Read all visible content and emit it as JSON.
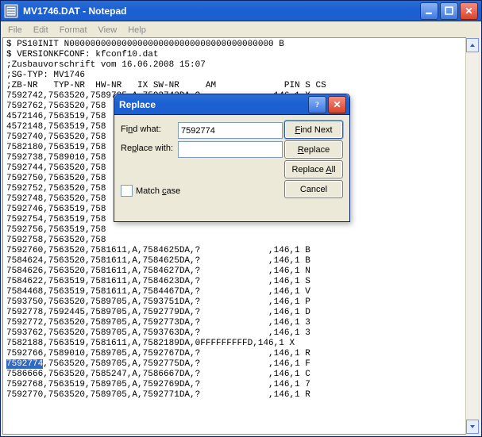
{
  "window": {
    "title": "MV1746.DAT - Notepad",
    "notepad_icon": "notepad-icon"
  },
  "menu": {
    "file": "File",
    "edit": "Edit",
    "format": "Format",
    "view": "View",
    "help": "Help"
  },
  "content": {
    "selected_token": "7592774",
    "lines_before_sel": "$ PS10INIT N000000000000000000000000000000000000000 B\n$ VERSIONKFCONF: kfconf10.dat\n;Zusbauvorschrift vom 16.06.2008 15:07\n;SG-TYP: MV1746\n;ZB-NR   TYP-NR  HW-NR   IX SW-NR     AM             PIN S CS\n7592742,7563520,7589705,A,7592743DA,?             ,146,1 X\n7592762,7563520,758\n4572146,7563519,758\n4572148,7563519,758\n7592740,7563520,758\n7582180,7563519,758\n7592738,7589010,758\n7592744,7563520,758\n7592750,7563520,758\n7592752,7563520,758\n7592748,7563520,758\n7592746,7563519,758\n7592754,7563519,758\n7592756,7563519,758\n7592758,7563520,758\n7592760,7563520,7581611,A,7584625DA,?             ,146,1 B\n7584624,7563520,7581611,A,7584625DA,?             ,146,1 B\n7584626,7563520,7581611,A,7584627DA,?             ,146,1 N\n7584622,7563519,7581611,A,7584623DA,?             ,146,1 S\n7584468,7563519,7581611,A,7584467DA,?             ,146,1 V\n7593750,7563520,7589705,A,7593751DA,?             ,146,1 P\n7592778,7592445,7589705,A,7592779DA,?             ,146,1 D\n7592772,7563520,7589705,A,7592773DA,?             ,146,1 3\n7593762,7563520,7589705,A,7593763DA,?             ,146,1 3\n7582188,7563519,7581611,A,7582189DA,0FFFFFFFFFD,146,1 X\n7592766,7589010,7589705,A,7592767DA,?             ,146,1 R\n",
    "lines_after_sel": ",7563520,7589705,A,7592775DA,?             ,146,1 F\n7586666,7563520,7585247,A,7586667DA,?             ,146,1 C\n7592768,7563519,7589705,A,7592769DA,?             ,146,1 7\n7592770,7563520,7589705,A,7592771DA,?             ,146,1 R\n"
  },
  "dialog": {
    "title": "Replace",
    "find_label_pre": "Fi",
    "find_label_ul": "n",
    "find_label_post": "d what:",
    "find_value": "7592774",
    "replace_label_pre": "Re",
    "replace_label_ul": "p",
    "replace_label_post": "lace with:",
    "replace_value": "",
    "match_case_pre": "Match ",
    "match_case_ul": "c",
    "match_case_post": "ase",
    "btn_find_pre": "",
    "btn_find_ul": "F",
    "btn_find_post": "ind Next",
    "btn_replace_pre": "",
    "btn_replace_ul": "R",
    "btn_replace_post": "eplace",
    "btn_replace_all_pre": "Replace ",
    "btn_replace_all_ul": "A",
    "btn_replace_all_post": "ll",
    "btn_cancel": "Cancel"
  }
}
